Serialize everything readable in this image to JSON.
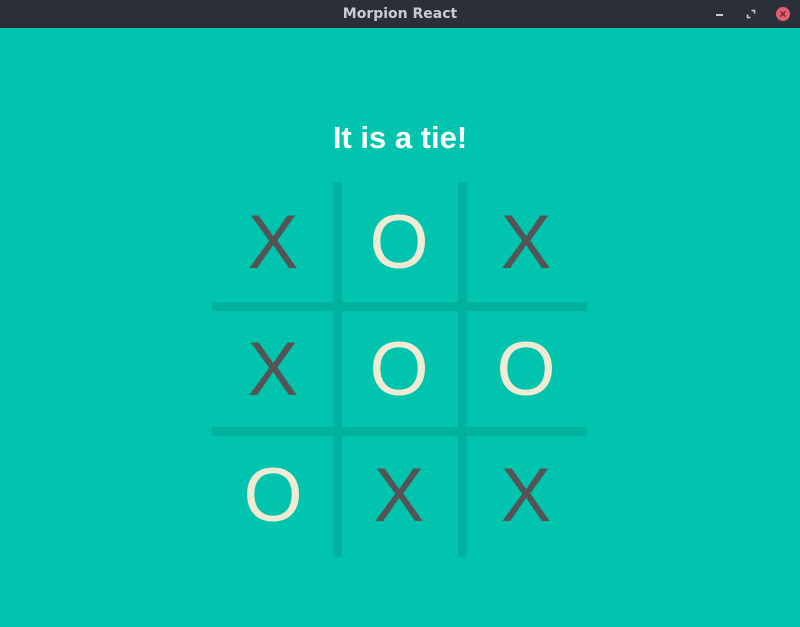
{
  "window": {
    "title": "Morpion React",
    "controls": {
      "minimize_icon": "minimize-icon",
      "maximize_icon": "maximize-icon",
      "close_icon": "close-icon"
    }
  },
  "game": {
    "status": "It is a tie!",
    "board": [
      [
        "X",
        "O",
        "X"
      ],
      [
        "X",
        "O",
        "O"
      ],
      [
        "O",
        "X",
        "X"
      ]
    ]
  },
  "colors": {
    "background": "#00c4ad",
    "grid_line": "#00b29d",
    "x_mark": "#545454",
    "o_mark": "#f2ebd3",
    "titlebar": "#2b2f3a",
    "close_button": "#e0606e"
  }
}
